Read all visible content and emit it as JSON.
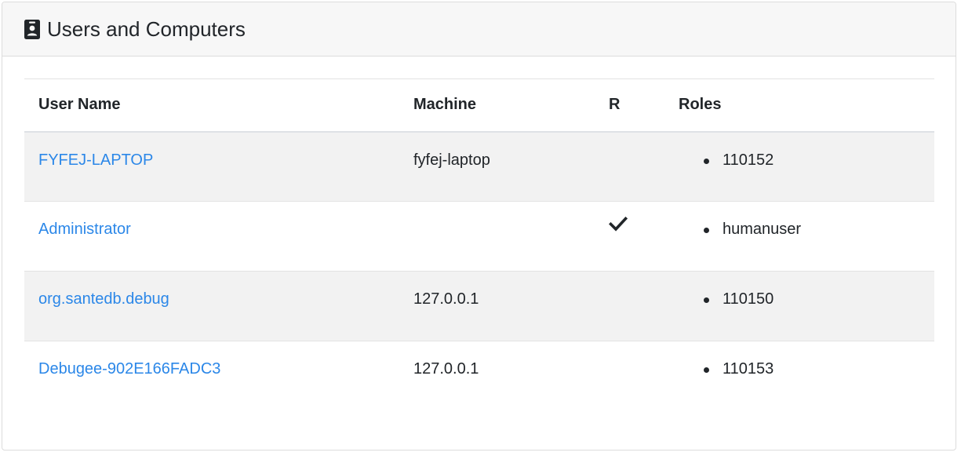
{
  "header": {
    "title": "Users and Computers",
    "icon": "id-badge-icon"
  },
  "table": {
    "columns": {
      "user_name": "User Name",
      "machine": "Machine",
      "r": "R",
      "roles": "Roles"
    },
    "rows": [
      {
        "user": "FYFEJ-LAPTOP",
        "machine": "fyfej-laptop",
        "r": false,
        "roles": [
          "110152"
        ]
      },
      {
        "user": "Administrator",
        "machine": "",
        "r": true,
        "roles": [
          "humanuser"
        ]
      },
      {
        "user": "org.santedb.debug",
        "machine": "127.0.0.1",
        "r": false,
        "roles": [
          "110150"
        ]
      },
      {
        "user": "Debugee-902E166FADC3",
        "machine": "127.0.0.1",
        "r": false,
        "roles": [
          "110153"
        ]
      }
    ]
  },
  "colors": {
    "link": "#2b87e8",
    "stripe": "#f2f2f2",
    "header_bg": "#f7f7f7"
  }
}
